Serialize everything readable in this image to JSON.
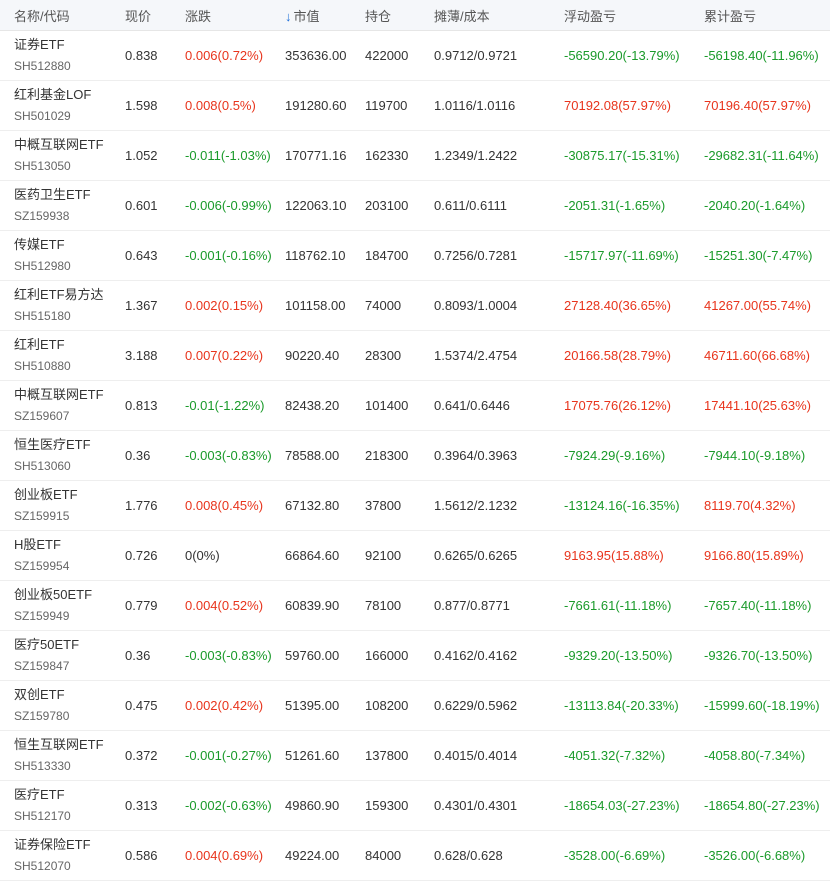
{
  "header": {
    "name": "名称/代码",
    "price": "现价",
    "change": "涨跌",
    "sort_icon": "↓",
    "market_value": "市值",
    "holdings": "持仓",
    "cost": "摊薄/成本",
    "floating_pl": "浮动盈亏",
    "accum_pl": "累计盈亏"
  },
  "colors": {
    "up": "#e8341c",
    "down": "#1a9a2a",
    "sort": "#1e6fd9"
  },
  "rows": [
    {
      "name": "证券ETF",
      "code": "SH512880",
      "price": "0.838",
      "change": "0.006(0.72%)",
      "change_dir": "up",
      "mv": "353636.00",
      "hold": "422000",
      "cost": "0.9712/0.9721",
      "float": "-56590.20(-13.79%)",
      "float_dir": "down",
      "acc": "-56198.40(-11.96%)",
      "acc_dir": "down"
    },
    {
      "name": "红利基金LOF",
      "code": "SH501029",
      "price": "1.598",
      "change": "0.008(0.5%)",
      "change_dir": "up",
      "mv": "191280.60",
      "hold": "119700",
      "cost": "1.0116/1.0116",
      "float": "70192.08(57.97%)",
      "float_dir": "up",
      "acc": "70196.40(57.97%)",
      "acc_dir": "up"
    },
    {
      "name": "中概互联网ETF",
      "code": "SH513050",
      "price": "1.052",
      "change": "-0.011(-1.03%)",
      "change_dir": "down",
      "mv": "170771.16",
      "hold": "162330",
      "cost": "1.2349/1.2422",
      "float": "-30875.17(-15.31%)",
      "float_dir": "down",
      "acc": "-29682.31(-11.64%)",
      "acc_dir": "down"
    },
    {
      "name": "医药卫生ETF",
      "code": "SZ159938",
      "price": "0.601",
      "change": "-0.006(-0.99%)",
      "change_dir": "down",
      "mv": "122063.10",
      "hold": "203100",
      "cost": "0.611/0.6111",
      "float": "-2051.31(-1.65%)",
      "float_dir": "down",
      "acc": "-2040.20(-1.64%)",
      "acc_dir": "down"
    },
    {
      "name": "传媒ETF",
      "code": "SH512980",
      "price": "0.643",
      "change": "-0.001(-0.16%)",
      "change_dir": "down",
      "mv": "118762.10",
      "hold": "184700",
      "cost": "0.7256/0.7281",
      "float": "-15717.97(-11.69%)",
      "float_dir": "down",
      "acc": "-15251.30(-7.47%)",
      "acc_dir": "down"
    },
    {
      "name": "红利ETF易方达",
      "code": "SH515180",
      "price": "1.367",
      "change": "0.002(0.15%)",
      "change_dir": "up",
      "mv": "101158.00",
      "hold": "74000",
      "cost": "0.8093/1.0004",
      "float": "27128.40(36.65%)",
      "float_dir": "up",
      "acc": "41267.00(55.74%)",
      "acc_dir": "up"
    },
    {
      "name": "红利ETF",
      "code": "SH510880",
      "price": "3.188",
      "change": "0.007(0.22%)",
      "change_dir": "up",
      "mv": "90220.40",
      "hold": "28300",
      "cost": "1.5374/2.4754",
      "float": "20166.58(28.79%)",
      "float_dir": "up",
      "acc": "46711.60(66.68%)",
      "acc_dir": "up"
    },
    {
      "name": "中概互联网ETF",
      "code": "SZ159607",
      "price": "0.813",
      "change": "-0.01(-1.22%)",
      "change_dir": "down",
      "mv": "82438.20",
      "hold": "101400",
      "cost": "0.641/0.6446",
      "float": "17075.76(26.12%)",
      "float_dir": "up",
      "acc": "17441.10(25.63%)",
      "acc_dir": "up"
    },
    {
      "name": "恒生医疗ETF",
      "code": "SH513060",
      "price": "0.36",
      "change": "-0.003(-0.83%)",
      "change_dir": "down",
      "mv": "78588.00",
      "hold": "218300",
      "cost": "0.3964/0.3963",
      "float": "-7924.29(-9.16%)",
      "float_dir": "down",
      "acc": "-7944.10(-9.18%)",
      "acc_dir": "down"
    },
    {
      "name": "创业板ETF",
      "code": "SZ159915",
      "price": "1.776",
      "change": "0.008(0.45%)",
      "change_dir": "up",
      "mv": "67132.80",
      "hold": "37800",
      "cost": "1.5612/2.1232",
      "float": "-13124.16(-16.35%)",
      "float_dir": "down",
      "acc": "8119.70(4.32%)",
      "acc_dir": "up"
    },
    {
      "name": "H股ETF",
      "code": "SZ159954",
      "price": "0.726",
      "change": "0(0%)",
      "change_dir": "flat",
      "mv": "66864.60",
      "hold": "92100",
      "cost": "0.6265/0.6265",
      "float": "9163.95(15.88%)",
      "float_dir": "up",
      "acc": "9166.80(15.89%)",
      "acc_dir": "up"
    },
    {
      "name": "创业板50ETF",
      "code": "SZ159949",
      "price": "0.779",
      "change": "0.004(0.52%)",
      "change_dir": "up",
      "mv": "60839.90",
      "hold": "78100",
      "cost": "0.877/0.8771",
      "float": "-7661.61(-11.18%)",
      "float_dir": "down",
      "acc": "-7657.40(-11.18%)",
      "acc_dir": "down"
    },
    {
      "name": "医疗50ETF",
      "code": "SZ159847",
      "price": "0.36",
      "change": "-0.003(-0.83%)",
      "change_dir": "down",
      "mv": "59760.00",
      "hold": "166000",
      "cost": "0.4162/0.4162",
      "float": "-9329.20(-13.50%)",
      "float_dir": "down",
      "acc": "-9326.70(-13.50%)",
      "acc_dir": "down"
    },
    {
      "name": "双创ETF",
      "code": "SZ159780",
      "price": "0.475",
      "change": "0.002(0.42%)",
      "change_dir": "up",
      "mv": "51395.00",
      "hold": "108200",
      "cost": "0.6229/0.5962",
      "float": "-13113.84(-20.33%)",
      "float_dir": "down",
      "acc": "-15999.60(-18.19%)",
      "acc_dir": "down"
    },
    {
      "name": "恒生互联网ETF",
      "code": "SH513330",
      "price": "0.372",
      "change": "-0.001(-0.27%)",
      "change_dir": "down",
      "mv": "51261.60",
      "hold": "137800",
      "cost": "0.4015/0.4014",
      "float": "-4051.32(-7.32%)",
      "float_dir": "down",
      "acc": "-4058.80(-7.34%)",
      "acc_dir": "down"
    },
    {
      "name": "医疗ETF",
      "code": "SH512170",
      "price": "0.313",
      "change": "-0.002(-0.63%)",
      "change_dir": "down",
      "mv": "49860.90",
      "hold": "159300",
      "cost": "0.4301/0.4301",
      "float": "-18654.03(-27.23%)",
      "float_dir": "down",
      "acc": "-18654.80(-27.23%)",
      "acc_dir": "down"
    },
    {
      "name": "证券保险ETF",
      "code": "SH512070",
      "price": "0.586",
      "change": "0.004(0.69%)",
      "change_dir": "up",
      "mv": "49224.00",
      "hold": "84000",
      "cost": "0.628/0.628",
      "float": "-3528.00(-6.69%)",
      "float_dir": "down",
      "acc": "-3526.00(-6.68%)",
      "acc_dir": "down"
    }
  ]
}
